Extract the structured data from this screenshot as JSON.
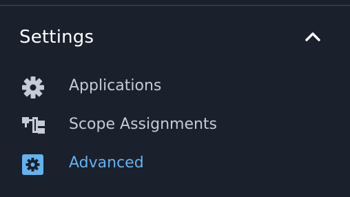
{
  "settings": {
    "title": "Settings",
    "expanded": true,
    "toggle_icon": "chevron-up-icon",
    "items": [
      {
        "label": "Applications",
        "icon": "gear-icon",
        "active": false
      },
      {
        "label": "Scope Assignments",
        "icon": "hierarchy-icon",
        "active": false
      },
      {
        "label": "Advanced",
        "icon": "gear-square-icon",
        "active": true
      }
    ]
  },
  "colors": {
    "background": "#1a202c",
    "text": "#c6ccd6",
    "title": "#ffffff",
    "active": "#63b3ed"
  }
}
